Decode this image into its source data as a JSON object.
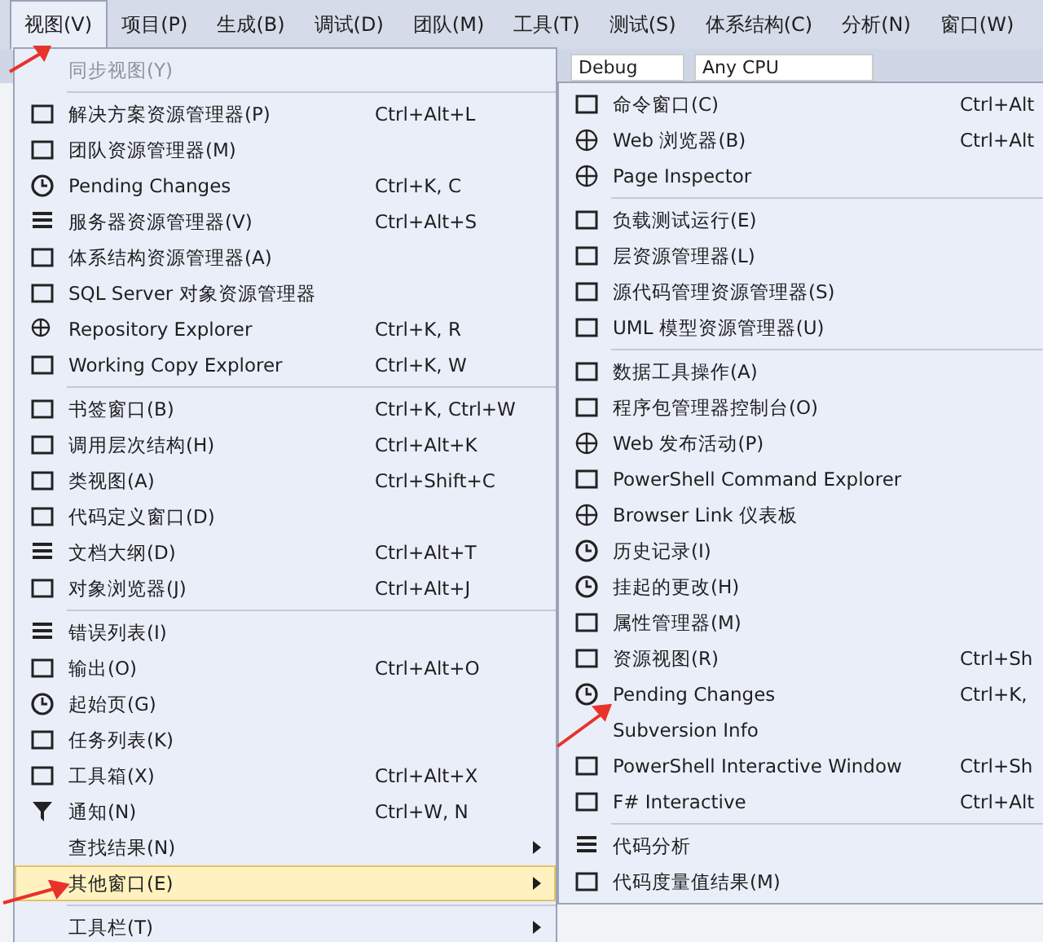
{
  "menu_bar": [
    {
      "label": "视图(V)",
      "selected": true
    },
    {
      "label": "项目(P)",
      "selected": false
    },
    {
      "label": "生成(B)",
      "selected": false
    },
    {
      "label": "调试(D)",
      "selected": false
    },
    {
      "label": "团队(M)",
      "selected": false
    },
    {
      "label": "工具(T)",
      "selected": false
    },
    {
      "label": "测试(S)",
      "selected": false
    },
    {
      "label": "体系结构(C)",
      "selected": false
    },
    {
      "label": "分析(N)",
      "selected": false
    },
    {
      "label": "窗口(W)",
      "selected": false
    }
  ],
  "toolbar": {
    "configuration": "Debug",
    "platform": "Any CPU"
  },
  "view_menu": [
    {
      "kind": "item",
      "label": "同步视图(Y)",
      "disabled": true,
      "selected": false
    },
    {
      "kind": "separator"
    },
    {
      "kind": "item",
      "label": "解决方案资源管理器(P)",
      "shortcut": "Ctrl+Alt+L",
      "disabled": false,
      "selected": false
    },
    {
      "kind": "item",
      "label": "团队资源管理器(M)",
      "disabled": false,
      "selected": false
    },
    {
      "kind": "item",
      "label": "Pending Changes",
      "shortcut": "Ctrl+K, C",
      "disabled": false,
      "selected": false
    },
    {
      "kind": "item",
      "label": "服务器资源管理器(V)",
      "shortcut": "Ctrl+Alt+S",
      "disabled": false,
      "selected": false
    },
    {
      "kind": "item",
      "label": "体系结构资源管理器(A)",
      "disabled": false,
      "selected": false
    },
    {
      "kind": "item",
      "label": "SQL Server 对象资源管理器",
      "disabled": false,
      "selected": false
    },
    {
      "kind": "item",
      "label": "Repository Explorer",
      "shortcut": "Ctrl+K, R",
      "disabled": false,
      "selected": false
    },
    {
      "kind": "item",
      "label": "Working Copy Explorer",
      "shortcut": "Ctrl+K, W",
      "disabled": false,
      "selected": false
    },
    {
      "kind": "separator"
    },
    {
      "kind": "item",
      "label": "书签窗口(B)",
      "shortcut": "Ctrl+K, Ctrl+W",
      "disabled": false,
      "selected": false
    },
    {
      "kind": "item",
      "label": "调用层次结构(H)",
      "shortcut": "Ctrl+Alt+K",
      "disabled": false,
      "selected": false
    },
    {
      "kind": "item",
      "label": "类视图(A)",
      "shortcut": "Ctrl+Shift+C",
      "disabled": false,
      "selected": false
    },
    {
      "kind": "item",
      "label": "代码定义窗口(D)",
      "disabled": false,
      "selected": false
    },
    {
      "kind": "item",
      "label": "文档大纲(D)",
      "shortcut": "Ctrl+Alt+T",
      "disabled": false,
      "selected": false
    },
    {
      "kind": "item",
      "label": "对象浏览器(J)",
      "shortcut": "Ctrl+Alt+J",
      "disabled": false,
      "selected": false
    },
    {
      "kind": "separator"
    },
    {
      "kind": "item",
      "label": "错误列表(I)",
      "disabled": false,
      "selected": false
    },
    {
      "kind": "item",
      "label": "输出(O)",
      "shortcut": "Ctrl+Alt+O",
      "disabled": false,
      "selected": false
    },
    {
      "kind": "item",
      "label": "起始页(G)",
      "disabled": false,
      "selected": false
    },
    {
      "kind": "item",
      "label": "任务列表(K)",
      "disabled": false,
      "selected": false
    },
    {
      "kind": "item",
      "label": "工具箱(X)",
      "shortcut": "Ctrl+Alt+X",
      "disabled": false,
      "selected": false
    },
    {
      "kind": "item",
      "label": "通知(N)",
      "shortcut": "Ctrl+W, N",
      "disabled": false,
      "selected": false
    },
    {
      "kind": "item",
      "label": "查找结果(N)",
      "submenu": true,
      "disabled": false,
      "selected": false
    },
    {
      "kind": "item",
      "label": "其他窗口(E)",
      "submenu": true,
      "disabled": false,
      "selected": true
    },
    {
      "kind": "separator"
    },
    {
      "kind": "item",
      "label": "工具栏(T)",
      "submenu": true,
      "disabled": false,
      "selected": false
    }
  ],
  "other_windows_menu": [
    {
      "kind": "item",
      "label": "命令窗口(C)",
      "shortcut": "Ctrl+Alt"
    },
    {
      "kind": "item",
      "label": "Web 浏览器(B)",
      "shortcut": "Ctrl+Alt"
    },
    {
      "kind": "item",
      "label": "Page Inspector"
    },
    {
      "kind": "separator"
    },
    {
      "kind": "item",
      "label": "负载测试运行(E)"
    },
    {
      "kind": "item",
      "label": "层资源管理器(L)"
    },
    {
      "kind": "item",
      "label": "源代码管理资源管理器(S)"
    },
    {
      "kind": "item",
      "label": "UML 模型资源管理器(U)"
    },
    {
      "kind": "separator"
    },
    {
      "kind": "item",
      "label": "数据工具操作(A)"
    },
    {
      "kind": "item",
      "label": "程序包管理器控制台(O)"
    },
    {
      "kind": "item",
      "label": "Web 发布活动(P)"
    },
    {
      "kind": "item",
      "label": "PowerShell Command Explorer"
    },
    {
      "kind": "item",
      "label": "Browser Link 仪表板"
    },
    {
      "kind": "item",
      "label": "历史记录(I)"
    },
    {
      "kind": "item",
      "label": "挂起的更改(H)"
    },
    {
      "kind": "item",
      "label": "属性管理器(M)"
    },
    {
      "kind": "item",
      "label": "资源视图(R)",
      "shortcut": "Ctrl+Sh"
    },
    {
      "kind": "item",
      "label": "Pending Changes",
      "shortcut": "Ctrl+K,"
    },
    {
      "kind": "item",
      "label": "Subversion Info"
    },
    {
      "kind": "item",
      "label": "PowerShell Interactive Window",
      "shortcut": "Ctrl+Sh"
    },
    {
      "kind": "item",
      "label": "F# Interactive",
      "shortcut": "Ctrl+Alt"
    },
    {
      "kind": "separator"
    },
    {
      "kind": "item",
      "label": "代码分析"
    },
    {
      "kind": "item",
      "label": "代码度量值结果(M)"
    }
  ]
}
